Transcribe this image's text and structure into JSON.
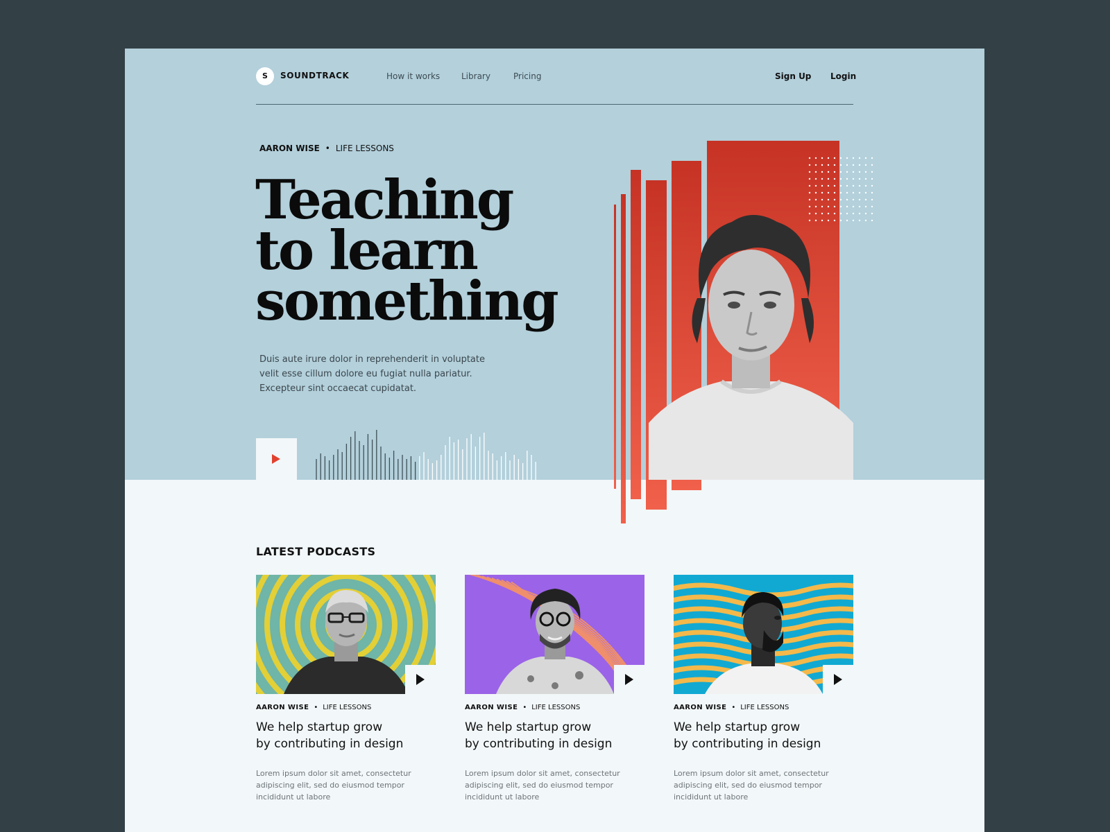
{
  "brand": {
    "mark": "S",
    "name": "SOUNDTRACK"
  },
  "nav": {
    "links": [
      "How it works",
      "Library",
      "Pricing"
    ],
    "signup": "Sign Up",
    "login": "Login"
  },
  "hero": {
    "author": "AARON WISE",
    "category": "LIFE LESSONS",
    "title_lines": [
      "Teaching",
      "to learn",
      "something"
    ],
    "description_lines": [
      "Duis aute irure dolor in reprehenderit in voluptate",
      "velit esse cillum dolore eu fugiat nulla pariatur.",
      "Excepteur sint occaecat cupidatat."
    ]
  },
  "latest": {
    "title": "LATEST PODCASTS",
    "cards": [
      {
        "author": "AARON WISE",
        "category": "LIFE LESSONS",
        "title_lines": [
          "We help startup grow",
          "by contributing in design"
        ],
        "desc_lines": [
          "Lorem ipsum dolor sit amet, consectetur",
          "adipiscing elit, sed do eiusmod tempor",
          "incididunt ut labore"
        ]
      },
      {
        "author": "AARON WISE",
        "category": "LIFE LESSONS",
        "title_lines": [
          "We help startup grow",
          "by contributing in design"
        ],
        "desc_lines": [
          "Lorem ipsum dolor sit amet, consectetur",
          "adipiscing elit, sed do eiusmod tempor",
          "incididunt ut labore"
        ]
      },
      {
        "author": "AARON WISE",
        "category": "LIFE LESSONS",
        "title_lines": [
          "We help startup grow",
          "by contributing in design"
        ],
        "desc_lines": [
          "Lorem ipsum dolor sit amet, consectetur",
          "adipiscing elit, sed do eiusmod tempor",
          "incididunt ut labore"
        ]
      }
    ]
  },
  "colors": {
    "page_bg": "#334046",
    "hero_bg": "#b3d0db",
    "content_bg": "#f2f7f9",
    "accent_red": "#e0422f",
    "card1_bg": "#6fb5a8",
    "card1_rings": "#e3cf36",
    "card2_bg": "#9b63e8",
    "card2_lines": "#ef8f6c",
    "card3_bg": "#11a9d2",
    "card3_waves": "#f4b94a"
  },
  "icons": {
    "hero_play": "play-icon",
    "card_play": "play-icon"
  }
}
